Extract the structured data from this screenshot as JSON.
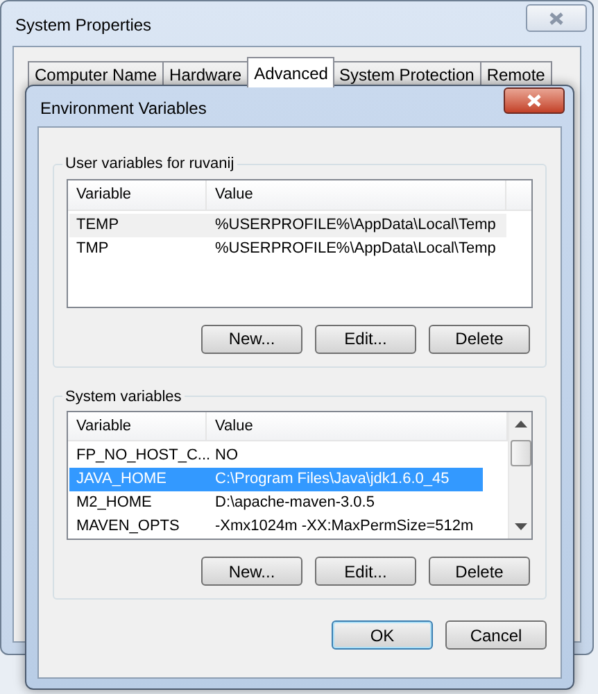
{
  "system_properties": {
    "title": "System Properties",
    "tabs": [
      {
        "label": "Computer Name",
        "selected": false
      },
      {
        "label": "Hardware",
        "selected": false
      },
      {
        "label": "Advanced",
        "selected": true
      },
      {
        "label": "System Protection",
        "selected": false
      },
      {
        "label": "Remote",
        "selected": false
      }
    ]
  },
  "environment_variables": {
    "title": "Environment Variables",
    "groups": [
      {
        "label": "User variables for ruvanij",
        "focused": false,
        "scrollbar": false,
        "columns": [
          "Variable",
          "Value"
        ],
        "rows": [
          {
            "variable": "TEMP",
            "value": "%USERPROFILE%\\AppData\\Local\\Temp",
            "selected": true
          },
          {
            "variable": "TMP",
            "value": "%USERPROFILE%\\AppData\\Local\\Temp",
            "selected": false
          }
        ],
        "buttons": [
          "New...",
          "Edit...",
          "Delete"
        ]
      },
      {
        "label": "System variables",
        "focused": true,
        "scrollbar": true,
        "columns": [
          "Variable",
          "Value"
        ],
        "rows": [
          {
            "variable": "FP_NO_HOST_C...",
            "value": "NO",
            "selected": false
          },
          {
            "variable": "JAVA_HOME",
            "value": "C:\\Program Files\\Java\\jdk1.6.0_45",
            "selected": true
          },
          {
            "variable": "M2_HOME",
            "value": "D:\\apache-maven-3.0.5",
            "selected": false
          },
          {
            "variable": "MAVEN_OPTS",
            "value": "-Xmx1024m -XX:MaxPermSize=512m",
            "selected": false
          }
        ],
        "buttons": [
          "New...",
          "Edit...",
          "Delete"
        ]
      }
    ],
    "buttons": [
      {
        "label": "OK",
        "default": true
      },
      {
        "label": "Cancel",
        "default": false
      }
    ]
  }
}
